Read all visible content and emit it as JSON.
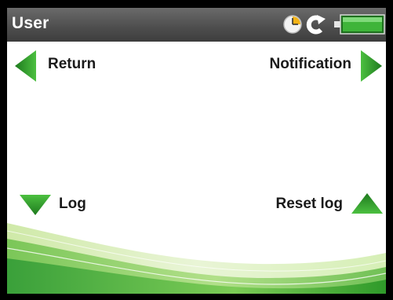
{
  "header": {
    "title": "User"
  },
  "status_icons": [
    "clock-icon",
    "refresh-icon",
    "battery-icon"
  ],
  "actions": {
    "return_label": "Return",
    "notification_label": "Notification",
    "log_label": "Log",
    "reset_log_label": "Reset log"
  },
  "colors": {
    "accent_green": "#2f9a2a",
    "titlebar": "#555555"
  }
}
